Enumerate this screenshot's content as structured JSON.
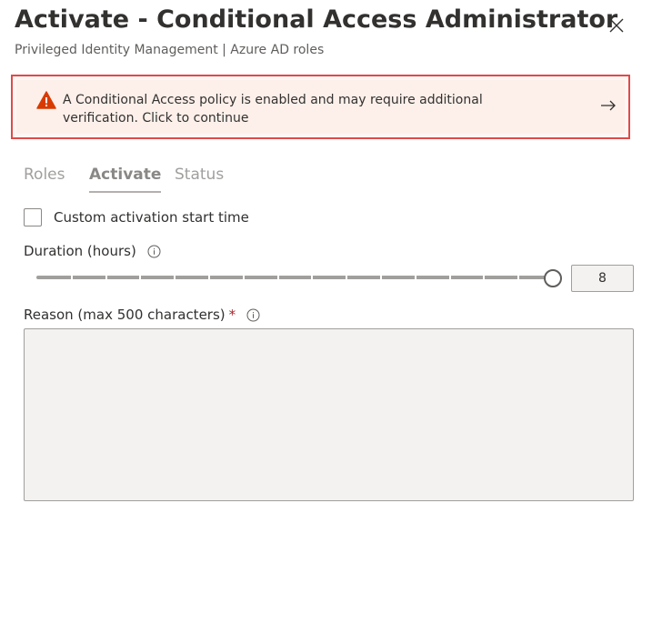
{
  "header": {
    "title": "Activate - Conditional Access Administrator",
    "subtitle": "Privileged Identity Management | Azure AD roles",
    "close_icon": "close-icon"
  },
  "banner": {
    "icon": "warning-icon",
    "icon_color": "#d83b01",
    "message": "A Conditional Access policy is enabled and may require additional verification. Click to continue",
    "action_icon": "arrow-right-icon",
    "highlight_color": "#e04a48"
  },
  "tabs": [
    {
      "label": "Roles",
      "active": false
    },
    {
      "label": "Activate",
      "active": true
    },
    {
      "label": "Status",
      "active": false
    }
  ],
  "custom_start": {
    "label": "Custom activation start time",
    "checked": false
  },
  "duration": {
    "label": "Duration (hours)",
    "info_icon": "info-icon",
    "value": "8",
    "slider_min": 0.5,
    "slider_max": 8,
    "slider_value": 8
  },
  "reason": {
    "label": "Reason (max 500 characters)",
    "required_marker": "*",
    "info_icon": "info-icon",
    "value": ""
  }
}
